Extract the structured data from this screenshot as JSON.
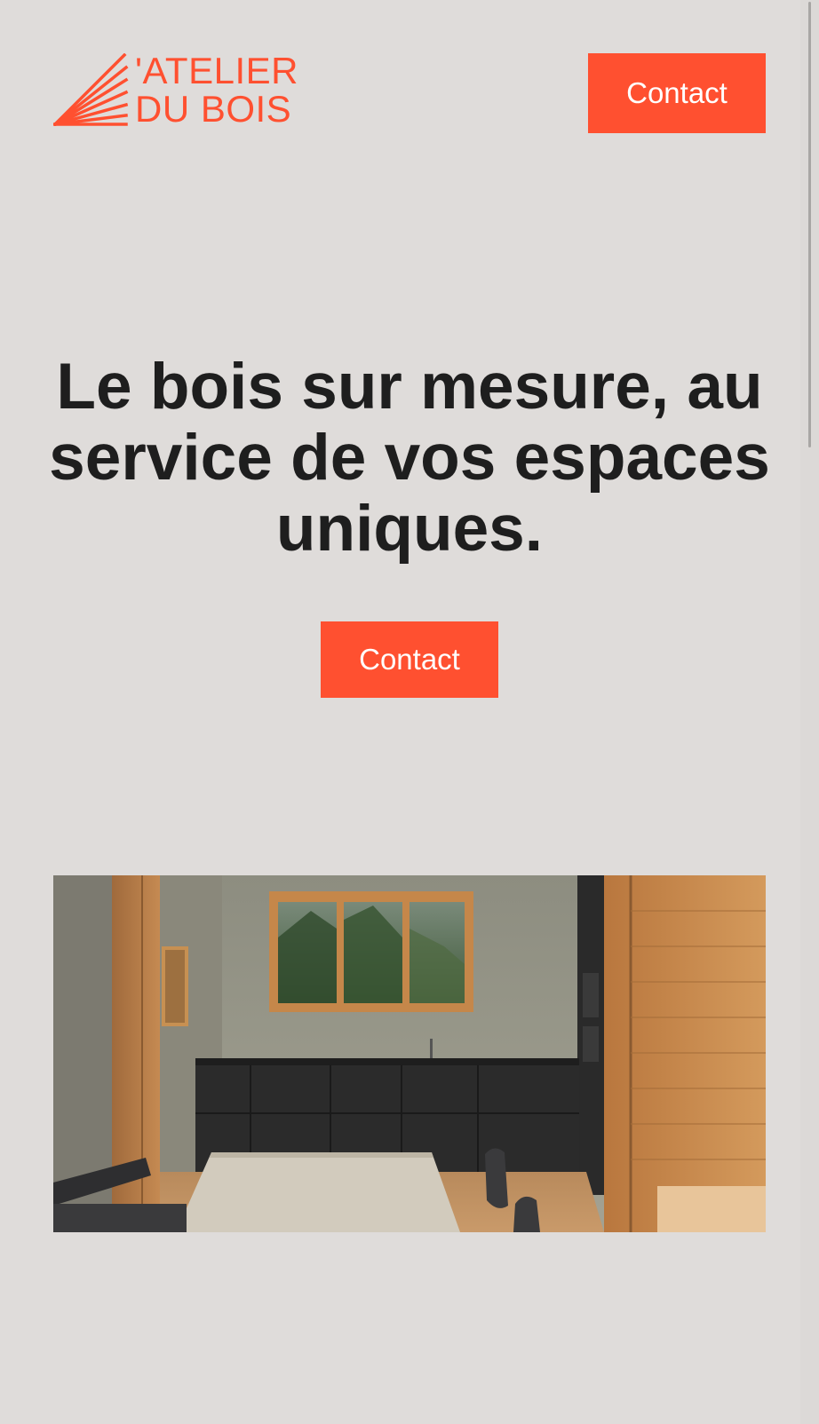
{
  "header": {
    "logo_line1": "'ATELIER",
    "logo_line2": "DU BOIS",
    "contact_label": "Contact"
  },
  "hero": {
    "title": "Le bois sur mesure, au service de vos espaces uniques.",
    "contact_label": "Contact"
  },
  "image": {
    "description_icon": "kitchen-photo"
  },
  "colors": {
    "accent": "#ff5030",
    "background": "#dfdcda",
    "text": "#1e1e1e"
  }
}
